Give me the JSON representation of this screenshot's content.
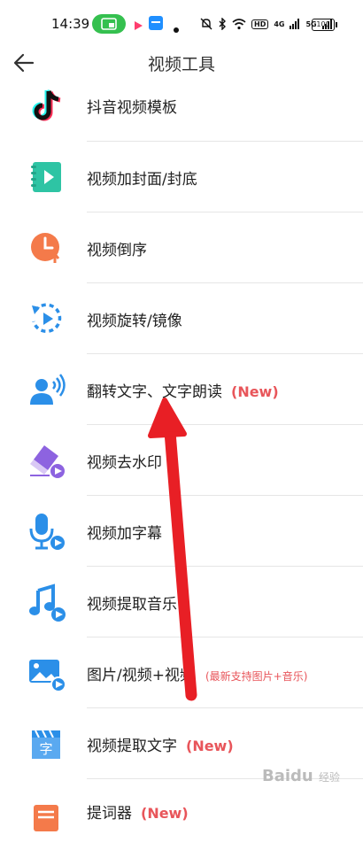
{
  "status_bar": {
    "time": "14:39",
    "battery": "100",
    "hd_label": "HD",
    "net_label_1": "4G",
    "net_label_2": "5G"
  },
  "header": {
    "title": "视频工具"
  },
  "items": [
    {
      "label": "抖音视频模板",
      "tag": "",
      "note": "",
      "icon": "tiktok-icon"
    },
    {
      "label": "视频加封面/封底",
      "tag": "",
      "note": "",
      "icon": "video-cover-icon"
    },
    {
      "label": "视频倒序",
      "tag": "",
      "note": "",
      "icon": "reverse-clock-icon"
    },
    {
      "label": "视频旋转/镜像",
      "tag": "",
      "note": "",
      "icon": "rotate-icon"
    },
    {
      "label": "翻转文字、文字朗读",
      "tag": "(New)",
      "note": "",
      "icon": "speaker-person-icon"
    },
    {
      "label": "视频去水印",
      "tag": "",
      "note": "",
      "icon": "eraser-icon"
    },
    {
      "label": "视频加字幕",
      "tag": "",
      "note": "",
      "icon": "microphone-icon"
    },
    {
      "label": "视频提取音乐",
      "tag": "",
      "note": "",
      "icon": "music-note-icon"
    },
    {
      "label": "图片/视频+视频",
      "tag": "",
      "note": "(最新支持图片+音乐)",
      "icon": "image-video-icon"
    },
    {
      "label": "视频提取文字",
      "tag": "(New)",
      "note": "",
      "icon": "clapper-text-icon"
    },
    {
      "label": "提词器",
      "tag": "(New)",
      "note": "",
      "icon": "teleprompter-icon"
    }
  ],
  "icon_glyph_text": "字",
  "watermark": {
    "brand": "Baidu",
    "sub": "经验"
  },
  "colors": {
    "accent_red": "#e8555a",
    "arrow_red": "#e81f25",
    "status_green": "#35c04f"
  }
}
